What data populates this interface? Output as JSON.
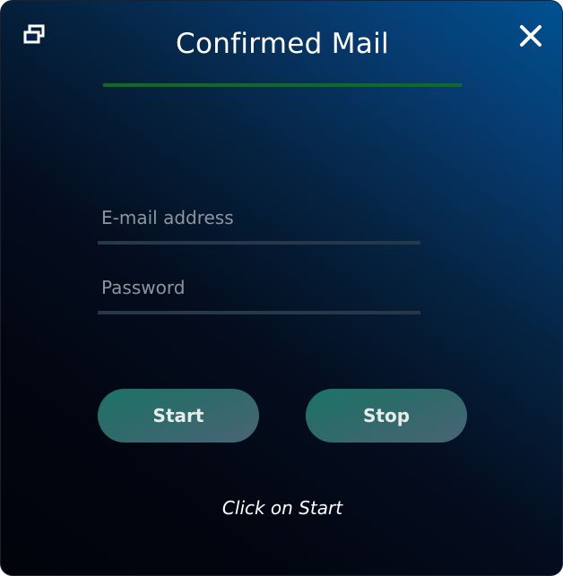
{
  "window": {
    "title": "Confirmed Mail",
    "restore_icon": "restore-window-icon",
    "close_icon": "close-icon"
  },
  "form": {
    "email": {
      "value": "",
      "placeholder": "E-mail address"
    },
    "password": {
      "value": "",
      "placeholder": "Password"
    }
  },
  "buttons": {
    "start_label": "Start",
    "stop_label": "Stop"
  },
  "status": {
    "text": "Click on Start"
  },
  "colors": {
    "accent_underline": "#0f6b22",
    "button_gradient_start": "#1c7366",
    "button_gradient_end": "#4a6476",
    "background_top": "#005191",
    "background_bottom": "#02040c"
  }
}
